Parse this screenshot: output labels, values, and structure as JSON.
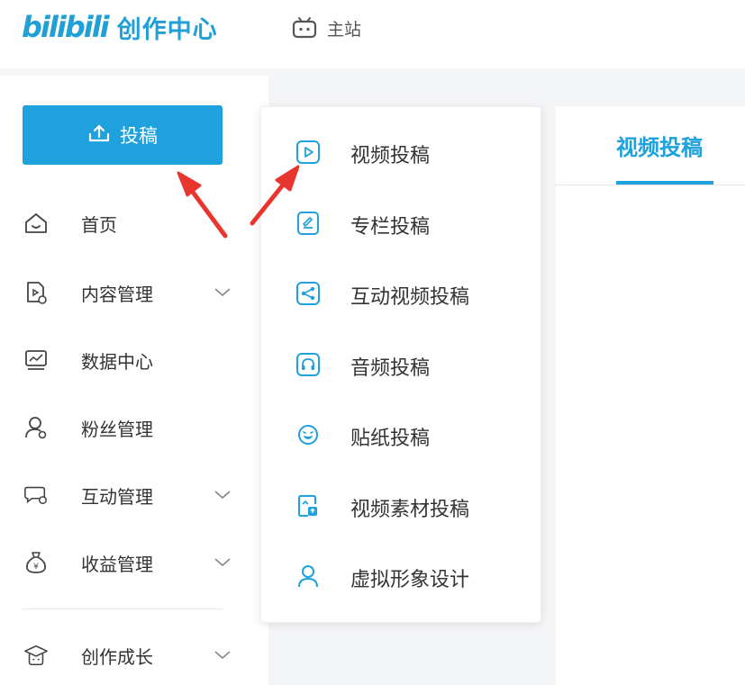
{
  "header": {
    "logo_mark": "bilibili",
    "logo_text": "创作中心",
    "main_site_icon": "tv-icon",
    "main_site_label": "主站"
  },
  "sidebar": {
    "upload_button": {
      "icon": "upload-icon",
      "label": "投稿"
    },
    "items": [
      {
        "icon": "home-icon",
        "label": "首页",
        "has_chevron": false
      },
      {
        "icon": "content-file-icon",
        "label": "内容管理",
        "has_chevron": true
      },
      {
        "icon": "chart-monitor-icon",
        "label": "数据中心",
        "has_chevron": false
      },
      {
        "icon": "fans-user-icon",
        "label": "粉丝管理",
        "has_chevron": false
      },
      {
        "icon": "chat-bubble-icon",
        "label": "互动管理",
        "has_chevron": true
      },
      {
        "icon": "money-bag-icon",
        "label": "收益管理",
        "has_chevron": true
      },
      {
        "icon": "graduation-cap-icon",
        "label": "创作成长",
        "has_chevron": true
      }
    ]
  },
  "dropdown": {
    "items": [
      {
        "icon": "play-video-icon",
        "label": "视频投稿"
      },
      {
        "icon": "article-edit-icon",
        "label": "专栏投稿"
      },
      {
        "icon": "interactive-share-icon",
        "label": "互动视频投稿"
      },
      {
        "icon": "headphones-icon",
        "label": "音频投稿"
      },
      {
        "icon": "sticker-face-icon",
        "label": "贴纸投稿"
      },
      {
        "icon": "material-upload-icon",
        "label": "视频素材投稿"
      },
      {
        "icon": "avatar-person-icon",
        "label": "虚拟形象设计"
      }
    ]
  },
  "tabs": {
    "active_label": "视频投稿"
  },
  "colors": {
    "accent": "#1ea1dc",
    "arrow": "#e8362f",
    "background": "#f4f5f7"
  }
}
